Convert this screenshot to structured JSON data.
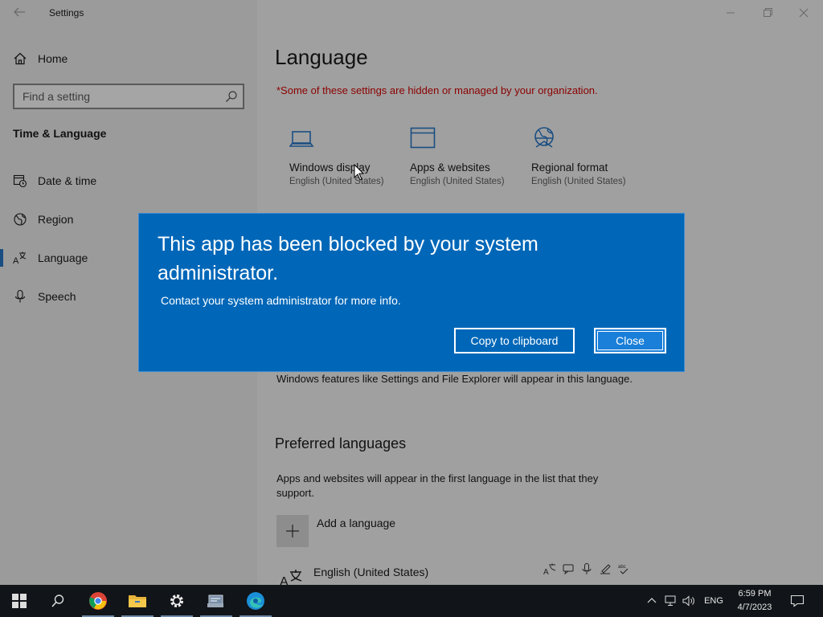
{
  "window": {
    "title": "Settings"
  },
  "sidebar": {
    "home_label": "Home",
    "search_placeholder": "Find a setting",
    "section_title": "Time & Language",
    "items": [
      {
        "label": "Date & time",
        "icon": "date-time-icon"
      },
      {
        "label": "Region",
        "icon": "globe-icon"
      },
      {
        "label": "Language",
        "icon": "language-icon",
        "selected": true
      },
      {
        "label": "Speech",
        "icon": "microphone-icon"
      }
    ]
  },
  "main": {
    "title": "Language",
    "org_warning": "*Some of these settings are hidden or managed by your organization.",
    "tiles": [
      {
        "title": "Windows display",
        "subtitle": "English (United States)",
        "icon": "laptop-icon"
      },
      {
        "title": "Apps & websites",
        "subtitle": "English (United States)",
        "icon": "browser-window-icon"
      },
      {
        "title": "Regional format",
        "subtitle": "English (United States)",
        "icon": "globe-format-icon"
      }
    ],
    "display_lang_desc": "Windows features like Settings and File Explorer will appear in this language.",
    "preferred_heading": "Preferred languages",
    "preferred_desc": "Apps and websites will appear in the first language in the list that they support.",
    "add_language": "Add a language",
    "languages": [
      {
        "name": "English (United States)"
      }
    ]
  },
  "dialog": {
    "title": "This app has been blocked by your system administrator.",
    "message": "Contact your system administrator for more info.",
    "copy_button": "Copy to clipboard",
    "close_button": "Close"
  },
  "taskbar": {
    "lang_indicator": "ENG",
    "time": "6:59 PM",
    "date": "4/7/2023"
  },
  "colors": {
    "dialog_bg": "#0067b8",
    "warning_text": "#8b0000",
    "taskbar_bg": "#111418"
  }
}
